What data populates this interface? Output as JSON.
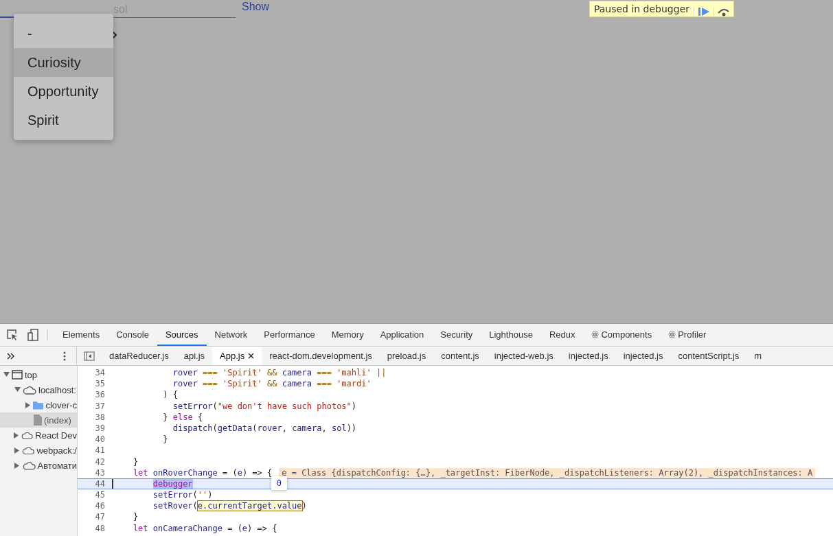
{
  "page": {
    "sol_field": {
      "placeholder": "sol"
    },
    "show_link": "Show",
    "debugger_badge": "Paused in debugger"
  },
  "rover_menu": [
    {
      "label": "-",
      "selected": false
    },
    {
      "label": "Curiosity",
      "selected": true
    },
    {
      "label": "Opportunity",
      "selected": false
    },
    {
      "label": "Spirit",
      "selected": false
    }
  ],
  "devtools": {
    "tabs": [
      {
        "label": "Elements",
        "selected": false,
        "react": false
      },
      {
        "label": "Console",
        "selected": false,
        "react": false
      },
      {
        "label": "Sources",
        "selected": true,
        "react": false
      },
      {
        "label": "Network",
        "selected": false,
        "react": false
      },
      {
        "label": "Performance",
        "selected": false,
        "react": false
      },
      {
        "label": "Memory",
        "selected": false,
        "react": false
      },
      {
        "label": "Application",
        "selected": false,
        "react": false
      },
      {
        "label": "Security",
        "selected": false,
        "react": false
      },
      {
        "label": "Lighthouse",
        "selected": false,
        "react": false
      },
      {
        "label": "Redux",
        "selected": false,
        "react": false
      },
      {
        "label": "Components",
        "selected": false,
        "react": true
      },
      {
        "label": "Profiler",
        "selected": false,
        "react": true
      }
    ],
    "file_tabs": [
      {
        "label": "dataReducer.js",
        "selected": false
      },
      {
        "label": "api.js",
        "selected": false
      },
      {
        "label": "App.js",
        "selected": true
      },
      {
        "label": "react-dom.development.js",
        "selected": false
      },
      {
        "label": "preload.js",
        "selected": false
      },
      {
        "label": "content.js",
        "selected": false
      },
      {
        "label": "injected-web.js",
        "selected": false
      },
      {
        "label": "injected.js",
        "selected": false
      },
      {
        "label": "injected.js",
        "selected": false
      },
      {
        "label": "contentScript.js",
        "selected": false
      },
      {
        "label": "m",
        "selected": false
      }
    ],
    "navigator": [
      {
        "label": "top",
        "kind": "frame",
        "expanded": true,
        "selected": false,
        "children": [
          {
            "label": "localhost:",
            "kind": "origin",
            "expanded": true,
            "selected": false,
            "children": [
              {
                "label": "clover-c",
                "kind": "folder",
                "expanded": false,
                "selected": false
              },
              {
                "label": "(index)",
                "kind": "file",
                "selected": true
              }
            ]
          },
          {
            "label": "React Dev",
            "kind": "origin",
            "expanded": false,
            "selected": false
          },
          {
            "label": "webpack:/",
            "kind": "origin",
            "expanded": false,
            "selected": false
          },
          {
            "label": "Автомати",
            "kind": "origin",
            "expanded": false,
            "selected": false
          }
        ]
      }
    ],
    "code": [
      {
        "num": "34",
        "current": false,
        "tokens": [
          {
            "t": "            rover",
            "kind": "var"
          },
          {
            "t": " === ",
            "kind": "op"
          },
          {
            "t": "'Spirit'",
            "kind": "str"
          },
          {
            "t": " && ",
            "kind": "op"
          },
          {
            "t": "camera",
            "kind": "var"
          },
          {
            "t": " === ",
            "kind": "op"
          },
          {
            "t": "'mahli'",
            "kind": "str"
          },
          {
            "t": " ||",
            "kind": "op"
          }
        ]
      },
      {
        "num": "35",
        "current": false,
        "tokens": [
          {
            "t": "            rover",
            "kind": "var"
          },
          {
            "t": " === ",
            "kind": "op"
          },
          {
            "t": "'Spirit'",
            "kind": "str"
          },
          {
            "t": " && ",
            "kind": "op"
          },
          {
            "t": "camera",
            "kind": "var"
          },
          {
            "t": " === ",
            "kind": "op"
          },
          {
            "t": "'mardi'",
            "kind": "str"
          }
        ]
      },
      {
        "num": "36",
        "current": false,
        "tokens": [
          {
            "t": "          ) {",
            "kind": "plain"
          }
        ]
      },
      {
        "num": "37",
        "current": false,
        "tokens": [
          {
            "t": "            setError",
            "kind": "var"
          },
          {
            "t": "(",
            "kind": "plain"
          },
          {
            "t": "\"we don't have such photos\"",
            "kind": "str2"
          },
          {
            "t": ")",
            "kind": "plain"
          }
        ]
      },
      {
        "num": "38",
        "current": false,
        "tokens": [
          {
            "t": "          } ",
            "kind": "plain"
          },
          {
            "t": "else",
            "kind": "kw"
          },
          {
            "t": " {",
            "kind": "plain"
          }
        ]
      },
      {
        "num": "39",
        "current": false,
        "tokens": [
          {
            "t": "            dispatch",
            "kind": "var"
          },
          {
            "t": "(",
            "kind": "plain"
          },
          {
            "t": "getData",
            "kind": "var"
          },
          {
            "t": "(",
            "kind": "plain"
          },
          {
            "t": "rover",
            "kind": "var"
          },
          {
            "t": ", ",
            "kind": "plain"
          },
          {
            "t": "camera",
            "kind": "var"
          },
          {
            "t": ", ",
            "kind": "plain"
          },
          {
            "t": "sol",
            "kind": "var"
          },
          {
            "t": "))",
            "kind": "plain"
          }
        ]
      },
      {
        "num": "40",
        "current": false,
        "tokens": [
          {
            "t": "          }",
            "kind": "plain"
          }
        ]
      },
      {
        "num": "41",
        "current": false
      },
      {
        "num": "42",
        "current": false,
        "tokens": [
          {
            "t": "    }",
            "kind": "plain"
          }
        ]
      },
      {
        "num": "43",
        "current": false,
        "tokens": [
          {
            "t": "    let",
            "kind": "kw"
          },
          {
            "t": " onRoverChange",
            "kind": "var"
          },
          {
            "t": " = (",
            "kind": "plain"
          },
          {
            "t": "e",
            "kind": "var"
          },
          {
            "t": ") => {",
            "kind": "plain"
          }
        ],
        "inline_value": "e = Class {dispatchConfig: {…}, _targetInst: FiberNode, _dispatchListeners: Array(2), _dispatchInstances: A"
      },
      {
        "num": "44",
        "current": true,
        "tokens": [
          {
            "t": "        debugger",
            "kind": "kw",
            "selected": true
          }
        ]
      },
      {
        "num": "45",
        "current": false,
        "tokens": [
          {
            "t": "        setError",
            "kind": "var"
          },
          {
            "t": "(",
            "kind": "plain"
          },
          {
            "t": "''",
            "kind": "str"
          },
          {
            "t": ")",
            "kind": "plain"
          }
        ]
      },
      {
        "num": "46",
        "current": false,
        "tokens": [
          {
            "t": "        setRover",
            "kind": "var"
          },
          {
            "t": "(",
            "kind": "plain"
          },
          {
            "t": "e.currentTarget.value",
            "kind": "var",
            "hovered": true,
            "tooltip": "0"
          },
          {
            "t": ")",
            "kind": "plain"
          }
        ]
      },
      {
        "num": "47",
        "current": false,
        "tokens": [
          {
            "t": "    }",
            "kind": "plain"
          }
        ]
      },
      {
        "num": "48",
        "current": false,
        "tokens": [
          {
            "t": "    let",
            "kind": "kw"
          },
          {
            "t": " onCameraChange",
            "kind": "var"
          },
          {
            "t": " = (",
            "kind": "plain"
          },
          {
            "t": "e",
            "kind": "var"
          },
          {
            "t": ") => {",
            "kind": "plain"
          }
        ]
      }
    ]
  }
}
